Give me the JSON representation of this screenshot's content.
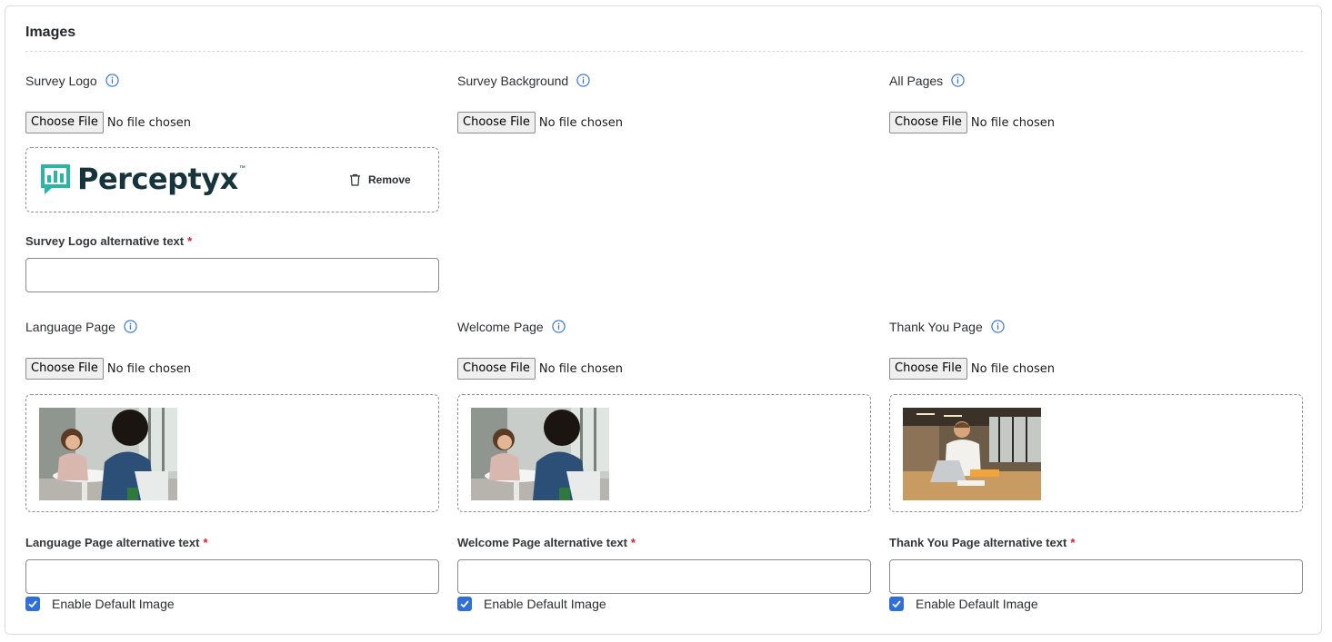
{
  "section": {
    "title": "Images"
  },
  "file_input": {
    "button_label": "Choose File",
    "status": "No file chosen"
  },
  "top_row": {
    "survey_logo": {
      "label": "Survey Logo",
      "logo_text": "Perceptyx",
      "logo_tm": "™",
      "remove_label": "Remove",
      "alt_label": "Survey Logo alternative text",
      "alt_value": ""
    },
    "survey_background": {
      "label": "Survey Background"
    },
    "all_pages": {
      "label": "All Pages"
    }
  },
  "bottom_row": {
    "language_page": {
      "label": "Language Page",
      "alt_label": "Language Page alternative text",
      "alt_value": "",
      "checkbox_label": "Enable Default Image",
      "checked": true
    },
    "welcome_page": {
      "label": "Welcome Page",
      "alt_label": "Welcome Page alternative text",
      "alt_value": "",
      "checkbox_label": "Enable Default Image",
      "checked": true
    },
    "thank_you_page": {
      "label": "Thank You Page",
      "alt_label": "Thank You Page alternative text",
      "alt_value": "",
      "checkbox_label": "Enable Default Image",
      "checked": true
    }
  },
  "required_marker": "*",
  "icons": {
    "info": "info-icon",
    "trash": "trash-icon",
    "check": "check-icon",
    "logo": "perceptyx-logo-icon"
  },
  "colors": {
    "info_icon": "#2f6fd6",
    "checkbox": "#2f6fd6",
    "required": "#d3212d",
    "logo_teal": "#2bb5a5",
    "logo_text": "#17343c"
  }
}
